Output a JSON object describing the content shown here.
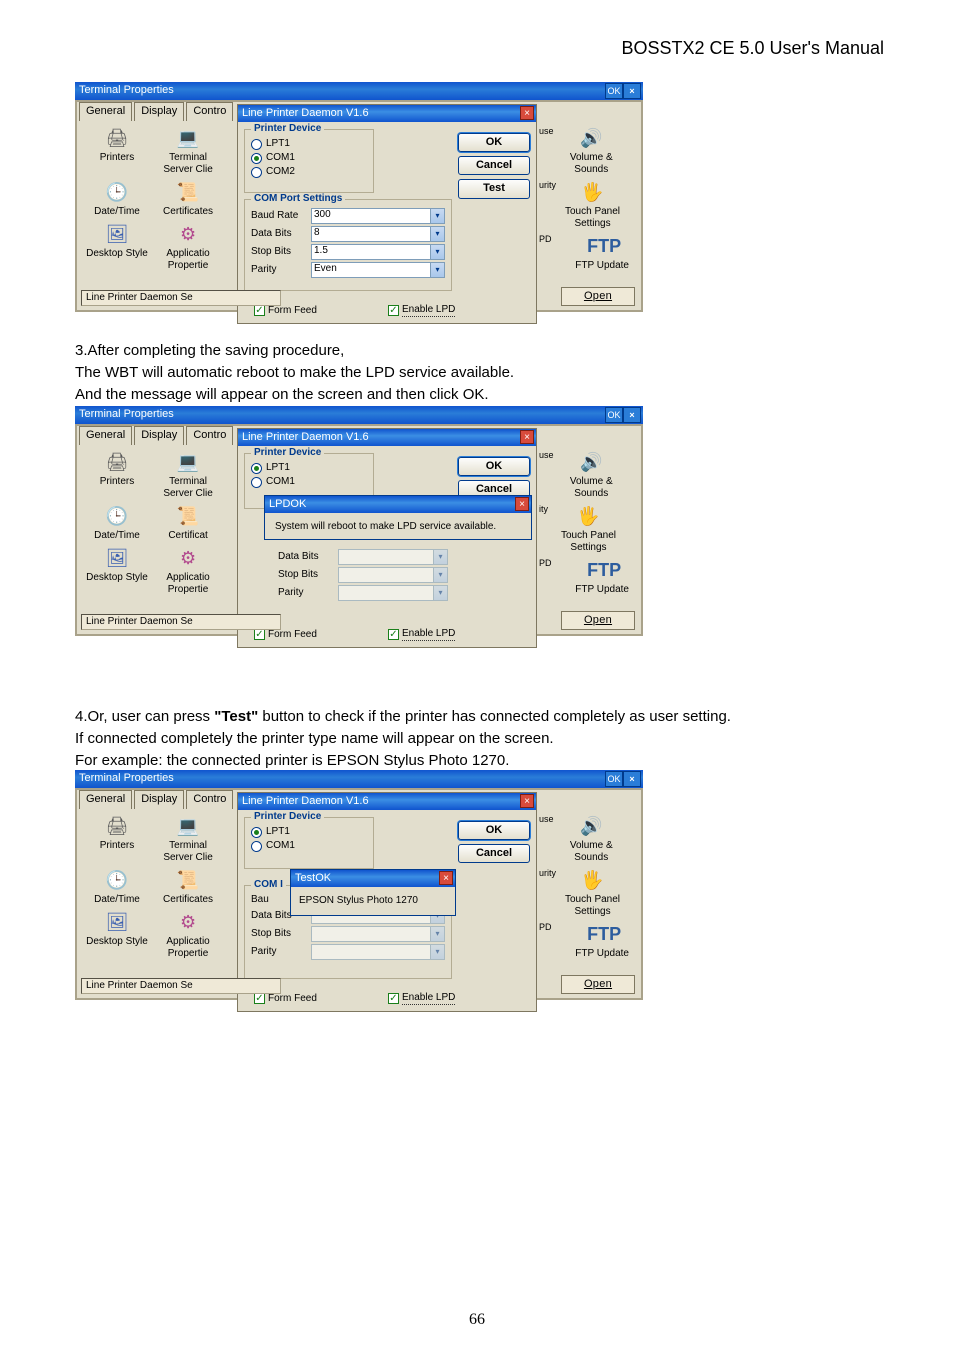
{
  "header": "BOSSTX2 CE 5.0 User's Manual",
  "page_number": "66",
  "para1_line1": "3.After completing the saving procedure,",
  "para1_line2": "The WBT will automatic reboot to make the LPD service available.",
  "para1_line3": "And the message will appear on the screen and then click OK.",
  "para2_line1": "4.Or, user can press \"Test\" button to check if the printer has connected completely as user setting.",
  "para2_line2": "If connected completely the printer type name will appear on the screen.",
  "para2_line3": "For example: the connected printer is EPSON Stylus Photo 1270.",
  "shot_common": {
    "terminal_title": "Terminal Properties",
    "ok_btn": "OK",
    "close_btn": "×",
    "tabs": {
      "general": "General",
      "display": "Display",
      "control": "Contro"
    },
    "dialog_title": "Line Printer Daemon V1.6",
    "device_group": "Printer Device",
    "radio_lpt1": "LPT1",
    "radio_com1": "COM1",
    "radio_com2": "COM2",
    "port_group": "COM Port Settings",
    "baud_label": "Baud Rate",
    "baud_val": "300",
    "data_label": "Data Bits",
    "data_val": "8",
    "stop_label": "Stop Bits",
    "stop_val": "1.5",
    "parity_label": "Parity",
    "parity_val": "Even",
    "form_feed": "Form Feed",
    "enable_lpd": "Enable LPD",
    "btn_ok": "OK",
    "btn_cancel": "Cancel",
    "btn_test": "Test",
    "statusbar": "Line Printer Daemon Se",
    "open_btn": "Open",
    "icons": {
      "printers": "Printers",
      "terminal": "Terminal Server Clie",
      "datetime": "Date/Time",
      "certs": "Certificates",
      "certs_s": "Certificat",
      "desktop": "Desktop Style",
      "app": "Applicatio Propertie",
      "mouse": "use",
      "volume": "Volume & Sounds",
      "security": "urity",
      "security_s": "ity",
      "touch": "Touch Panel Settings",
      "pd": "PD",
      "ftp": "FTP Update",
      "ftp_logo": "FTP"
    }
  },
  "shot2": {
    "msg_title": "LPD",
    "msg_text": "System will reboot to make LPD service available."
  },
  "shot3": {
    "test_title": "Test",
    "com_group": "COM I",
    "bau_label": "Bau",
    "test_result": "EPSON Stylus Photo 1270"
  }
}
